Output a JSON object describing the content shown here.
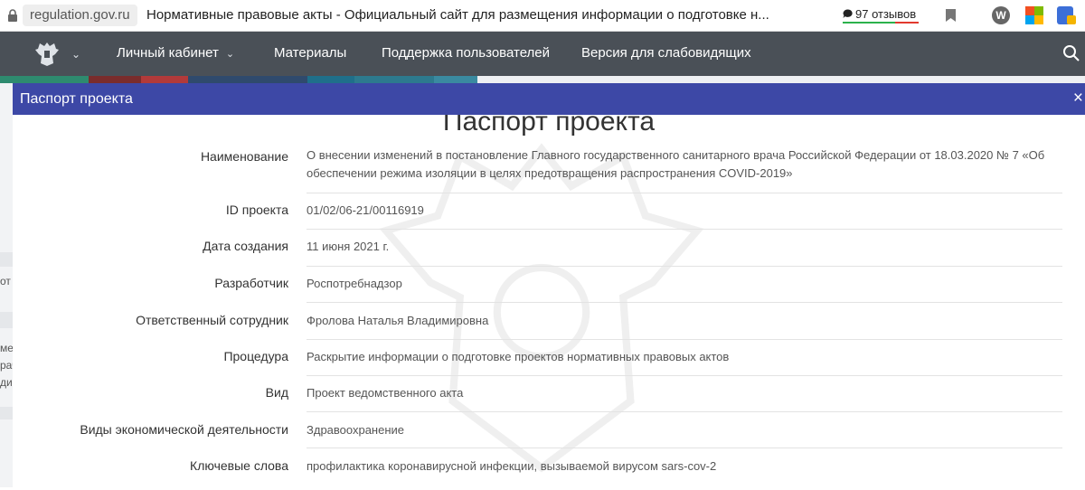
{
  "browser": {
    "domain": "regulation.gov.ru",
    "page_title": "Нормативные правовые акты - Официальный сайт для размещения информации о подготовке н...",
    "reviews": "97 отзывов",
    "extension_w": "W"
  },
  "nav": {
    "items": [
      "Личный кабинет",
      "Материалы",
      "Поддержка пользователей",
      "Версия для слабовидящих"
    ]
  },
  "background": {
    "left_text": [
      "от",
      "ме",
      "рач",
      "ди"
    ]
  },
  "modal": {
    "header_title": "Паспорт проекта",
    "close_label": "×",
    "heading": "Паспорт проекта",
    "fields": [
      {
        "label": "Наименование",
        "value": "О внесении изменений в постановление Главного государственного санитарного врача Российской Федерации от 18.03.2020 № 7 «Об обеспечении режима изоляции в целях предотвращения распространения COVID-2019»"
      },
      {
        "label": "ID проекта",
        "value": "01/02/06-21/00116919"
      },
      {
        "label": "Дата создания",
        "value": "11 июня 2021 г."
      },
      {
        "label": "Разработчик",
        "value": "Роспотребнадзор"
      },
      {
        "label": "Ответственный сотрудник",
        "value": "Фролова Наталья Владимировна"
      },
      {
        "label": "Процедура",
        "value": "Раскрытие информации о подготовке проектов нормативных правовых актов"
      },
      {
        "label": "Вид",
        "value": "Проект ведомственного акта"
      },
      {
        "label": "Виды экономической деятельности",
        "value": "Здравоохранение"
      },
      {
        "label": "Ключевые слова",
        "value": "профилактика коронавирусной инфекции, вызываемой вирусом sars-cov-2"
      }
    ]
  }
}
